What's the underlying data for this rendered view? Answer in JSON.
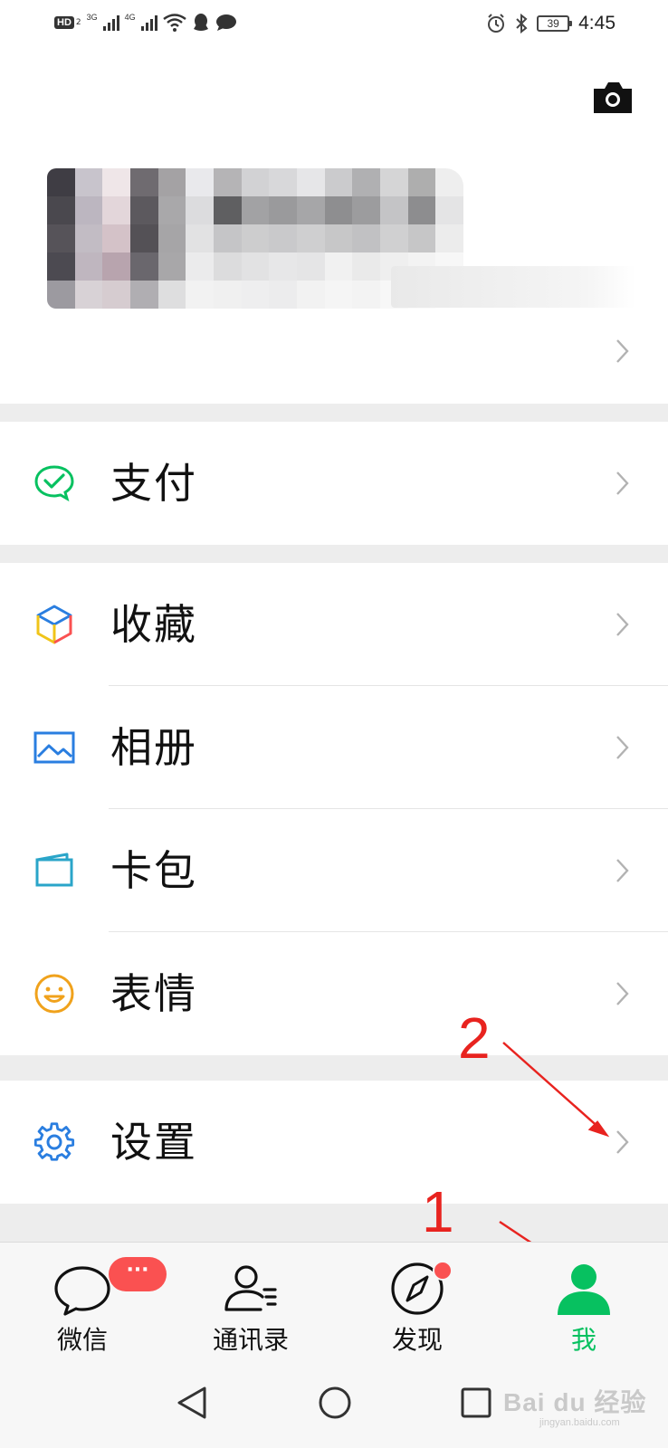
{
  "status_bar": {
    "hd": "HD",
    "hd_sub": "2",
    "net1": "3G",
    "net2": "4G",
    "battery": "39",
    "time": "4:45"
  },
  "menu": {
    "pay": {
      "label": "支付",
      "icon": "wechat-pay-icon",
      "color": "#07c160"
    },
    "favorites": {
      "label": "收藏",
      "icon": "favorites-cube-icon"
    },
    "album": {
      "label": "相册",
      "icon": "image-icon",
      "color": "#2a7ee0"
    },
    "cards": {
      "label": "卡包",
      "icon": "card-wallet-icon",
      "color": "#2a7ee0"
    },
    "stickers": {
      "label": "表情",
      "icon": "smiley-icon",
      "color": "#f0a21c"
    },
    "settings": {
      "label": "设置",
      "icon": "gear-icon",
      "color": "#2a7ee0"
    }
  },
  "annotations": {
    "one": "1",
    "two": "2",
    "color": "#e8231f"
  },
  "tabbar": {
    "chats": {
      "label": "微信",
      "badge": "···"
    },
    "contacts": {
      "label": "通讯录"
    },
    "discover": {
      "label": "发现"
    },
    "me": {
      "label": "我",
      "active_color": "#07c160"
    }
  },
  "watermark": {
    "main": "Bai du 经验",
    "sub": "jingyan.baidu.com"
  }
}
